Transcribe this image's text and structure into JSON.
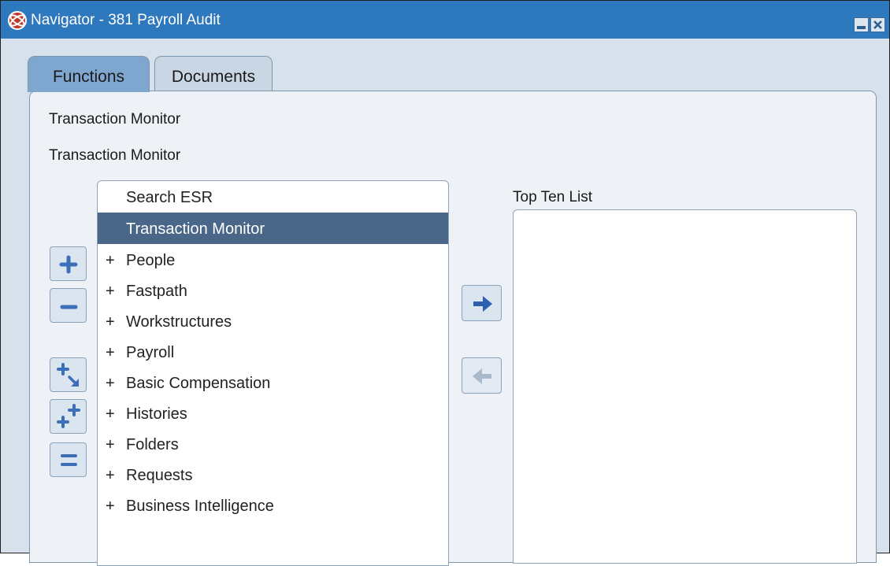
{
  "window": {
    "title": "Navigator - 381 Payroll Audit",
    "icon": "oracle-app-icon",
    "controls": [
      "minimize-icon",
      "close-icon"
    ]
  },
  "tabs": [
    {
      "label": "Functions",
      "active": true
    },
    {
      "label": "Documents",
      "active": false
    }
  ],
  "current_function": {
    "line1": "Transaction Monitor",
    "line2": "Transaction Monitor"
  },
  "tree": {
    "items": [
      {
        "prefix": "",
        "label": "Search ESR"
      },
      {
        "prefix": "",
        "label": "Transaction Monitor",
        "selected": true
      },
      {
        "prefix": "+",
        "label": "People"
      },
      {
        "prefix": "+",
        "label": "Fastpath"
      },
      {
        "prefix": "+",
        "label": "Workstructures"
      },
      {
        "prefix": "+",
        "label": "Payroll"
      },
      {
        "prefix": "+",
        "label": "Basic Compensation"
      },
      {
        "prefix": "+",
        "label": "Histories"
      },
      {
        "prefix": "+",
        "label": "Folders"
      },
      {
        "prefix": "+",
        "label": "Requests"
      },
      {
        "prefix": "+",
        "label": "Business Intelligence"
      }
    ]
  },
  "tree_controls": [
    "expand-icon",
    "collapse-icon",
    "expand-branch-icon",
    "expand-all-icon",
    "collapse-all-icon"
  ],
  "top_ten": {
    "label": "Top Ten List",
    "items": []
  },
  "transfer": [
    "arrow-right-icon",
    "arrow-left-icon"
  ],
  "colors": {
    "titlebar": "#2e78bd",
    "selection": "#4a6789",
    "active_tab": "#7ea6cf",
    "inactive_tab": "#c9d6e3",
    "button_icon": "#3d6fb8"
  }
}
